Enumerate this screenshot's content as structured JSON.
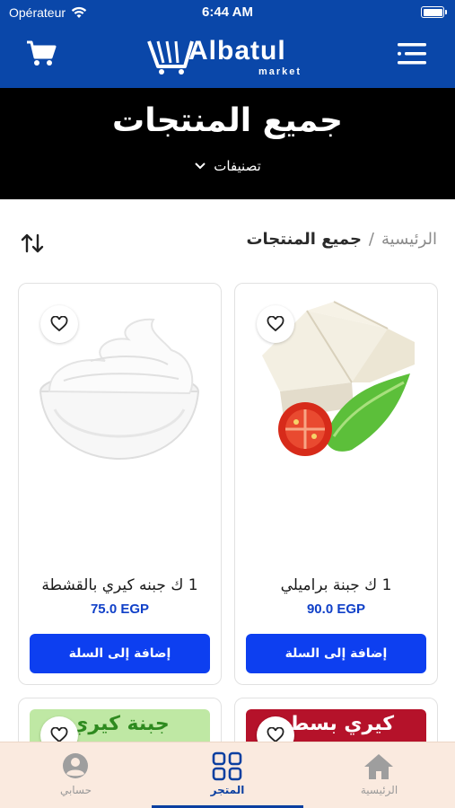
{
  "status": {
    "carrier": "Opérateur",
    "time": "6:44 AM",
    "battery_level": 1.0
  },
  "header": {
    "logo_main": "Albatul",
    "logo_sub": "market"
  },
  "hero": {
    "title": "جميع المنتجات",
    "categories_label": "تصنيفات"
  },
  "breadcrumb": {
    "home": "الرئيسية",
    "separator": "/",
    "current": "جميع المنتجات"
  },
  "products": [
    {
      "name": "1 ك جبنة براميلي",
      "price": "90.0 EGP",
      "add_label": "إضافة إلى السلة"
    },
    {
      "name": "1 ك جبنه كيري بالقشطة",
      "price": "75.0 EGP",
      "add_label": "إضافة إلى السلة"
    }
  ],
  "next_products": [
    {
      "banner_text": "كيري بسطر"
    },
    {
      "banner_text": "جبنة كيري"
    }
  ],
  "tabs": [
    {
      "label": "الرئيسية",
      "icon": "home-icon"
    },
    {
      "label": "المتجر",
      "icon": "grid-icon"
    },
    {
      "label": "حسابي",
      "icon": "user-icon"
    }
  ],
  "colors": {
    "brand_blue": "#0a47a9",
    "button_blue": "#0d3ff0",
    "price_blue": "#1040c8",
    "tab_bar_bg": "#faeadf"
  }
}
